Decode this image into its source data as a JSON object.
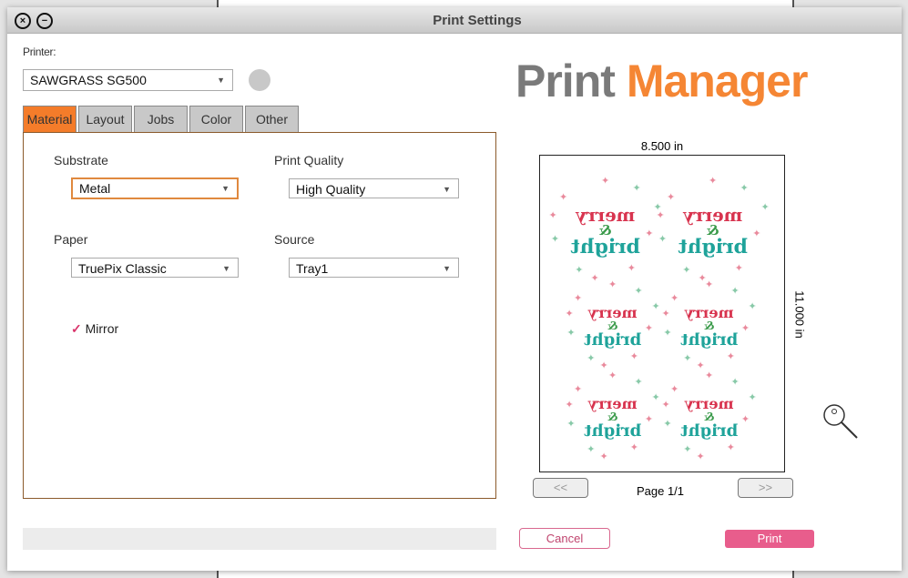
{
  "window": {
    "title": "Print Settings"
  },
  "printer": {
    "label": "Printer:",
    "selected": "SAWGRASS SG500",
    "status_color": "#c8c8c8"
  },
  "tabs": [
    {
      "label": "Material",
      "active": true
    },
    {
      "label": "Layout",
      "active": false
    },
    {
      "label": "Jobs",
      "active": false
    },
    {
      "label": "Color",
      "active": false
    },
    {
      "label": "Other",
      "active": false
    }
  ],
  "material": {
    "substrate": {
      "label": "Substrate",
      "value": "Metal"
    },
    "print_quality": {
      "label": "Print Quality",
      "value": "High Quality"
    },
    "paper": {
      "label": "Paper",
      "value": "TruePix Classic"
    },
    "source": {
      "label": "Source",
      "value": "Tray1"
    },
    "mirror": {
      "label": "Mirror",
      "checked": true
    }
  },
  "logo": {
    "part1": "Print",
    "part2": "Manager",
    "color1": "#7a7a7a",
    "color2": "#f58634"
  },
  "preview": {
    "width_label": "8.500 in",
    "height_label": "11.000 in",
    "artwork": {
      "line1": "merry",
      "line2": "&",
      "line3": "bright"
    },
    "prev_label": "<<",
    "next_label": ">>",
    "page_label": "Page 1/1"
  },
  "actions": {
    "cancel": "Cancel",
    "print": "Print",
    "accent": "#e85d8c"
  },
  "colors": {
    "accent_orange": "#f47c2a",
    "pink": "#e85d8c"
  }
}
